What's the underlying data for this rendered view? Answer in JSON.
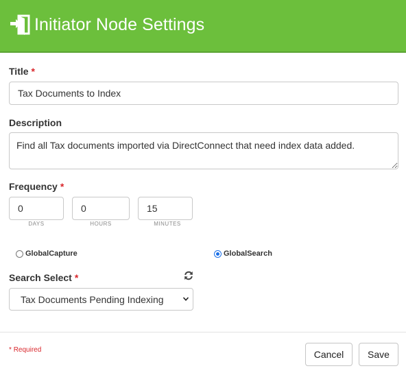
{
  "header": {
    "title": "Initiator Node Settings",
    "icon": "sign-in-icon",
    "background": "#6cbf3c"
  },
  "form": {
    "title": {
      "label": "Title",
      "required_mark": "*",
      "value": "Tax Documents to Index"
    },
    "description": {
      "label": "Description",
      "value": "Find all Tax documents imported via DirectConnect that need index data added."
    },
    "frequency": {
      "label": "Frequency",
      "required_mark": "*",
      "days": {
        "value": "0",
        "unit": "DAYS"
      },
      "hours": {
        "value": "0",
        "unit": "HOURS"
      },
      "minutes": {
        "value": "15",
        "unit": "MINUTES"
      }
    },
    "source": {
      "options": [
        {
          "label": "GlobalCapture",
          "checked": false
        },
        {
          "label": "GlobalSearch",
          "checked": true
        }
      ]
    },
    "search_select": {
      "label": "Search Select",
      "required_mark": "*",
      "value": "Tax Documents Pending Indexing",
      "refresh_icon": "refresh-icon"
    }
  },
  "footer": {
    "required_mark": "*",
    "required_note": "Required",
    "cancel_label": "Cancel",
    "save_label": "Save"
  }
}
